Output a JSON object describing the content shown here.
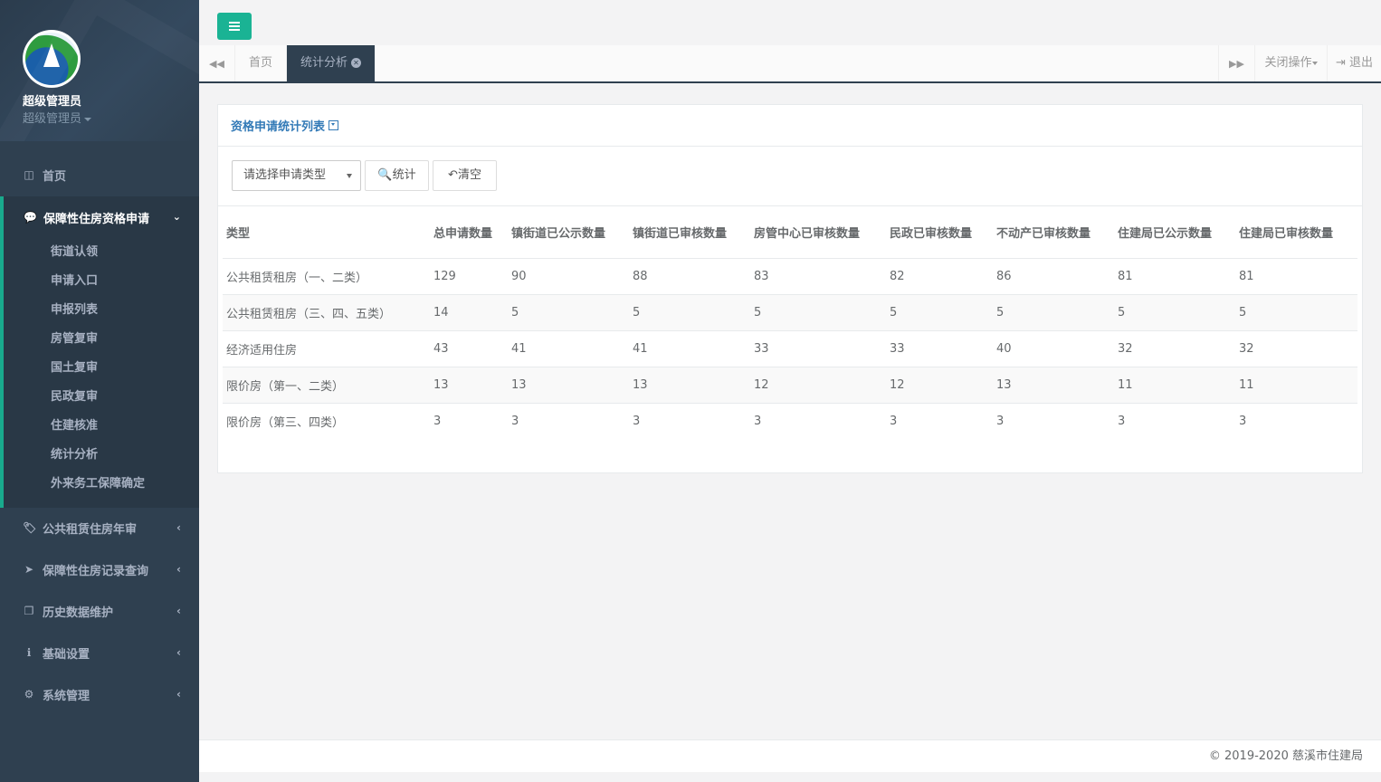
{
  "profile": {
    "name": "超级管理员",
    "role": "超级管理员"
  },
  "sidebar": {
    "home": "首页",
    "open_group": {
      "label": "保障性住房资格申请",
      "items": [
        "街道认领",
        "申请入口",
        "申报列表",
        "房管复审",
        "国土复审",
        "民政复审",
        "住建核准",
        "统计分析",
        "外来务工保障确定"
      ]
    },
    "groups": [
      {
        "label": "公共租赁住房年审",
        "icon": "tag-icon"
      },
      {
        "label": "保障性住房记录查询",
        "icon": "paper-plane-icon"
      },
      {
        "label": "历史数据维护",
        "icon": "copy-icon"
      },
      {
        "label": "基础设置",
        "icon": "info-icon"
      },
      {
        "label": "系统管理",
        "icon": "gear-icon"
      }
    ]
  },
  "tabs": {
    "home": "首页",
    "active": "统计分析",
    "close_ops": "关闭操作",
    "logout": "退出"
  },
  "panel": {
    "title": "资格申请统计列表",
    "select_placeholder": "请选择申请类型",
    "stat_button": "统计",
    "clear_button": "清空"
  },
  "table": {
    "headers": [
      "类型",
      "总申请数量",
      "镇街道已公示数量",
      "镇街道已审核数量",
      "房管中心已审核数量",
      "民政已审核数量",
      "不动产已审核数量",
      "住建局已公示数量",
      "住建局已审核数量"
    ],
    "rows": [
      [
        "公共租赁租房（一、二类）",
        "129",
        "90",
        "88",
        "83",
        "82",
        "86",
        "81",
        "81"
      ],
      [
        "公共租赁租房（三、四、五类）",
        "14",
        "5",
        "5",
        "5",
        "5",
        "5",
        "5",
        "5"
      ],
      [
        "经济适用住房",
        "43",
        "41",
        "41",
        "33",
        "33",
        "40",
        "32",
        "32"
      ],
      [
        "限价房（第一、二类）",
        "13",
        "13",
        "13",
        "12",
        "12",
        "13",
        "11",
        "11"
      ],
      [
        "限价房（第三、四类）",
        "3",
        "3",
        "3",
        "3",
        "3",
        "3",
        "3",
        "3"
      ]
    ]
  },
  "footer": {
    "copyright": "© 2019-2020 慈溪市住建局"
  },
  "colors": {
    "sidebar": "#2f4050",
    "accent": "#1ab394",
    "link": "#337ab7"
  }
}
